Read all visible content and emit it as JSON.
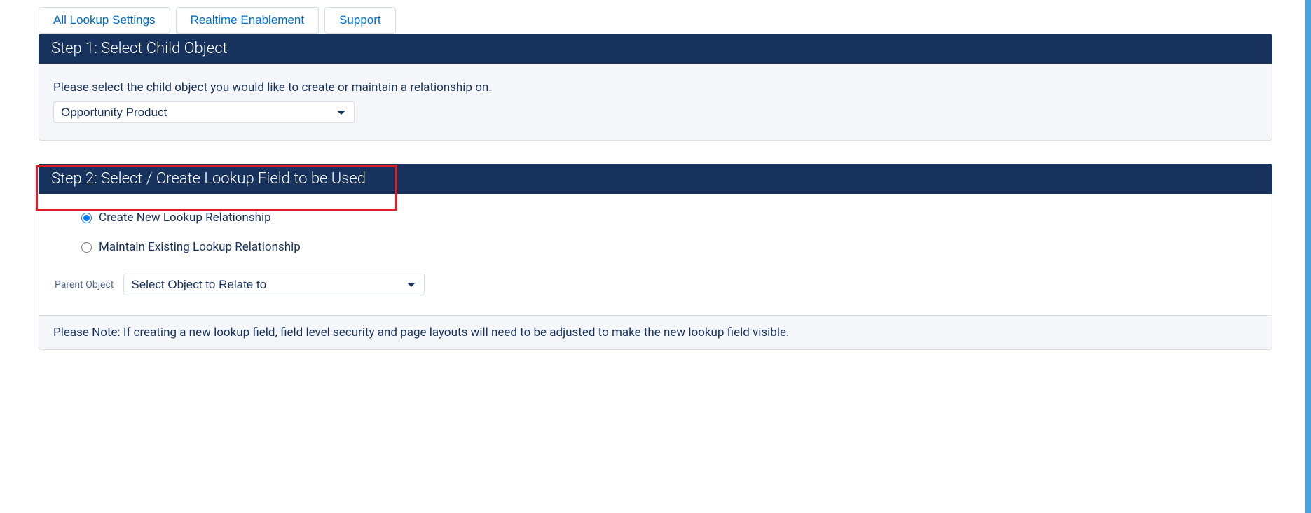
{
  "tabs": {
    "all_lookup_settings": "All Lookup Settings",
    "realtime_enablement": "Realtime Enablement",
    "support": "Support"
  },
  "step1": {
    "title": "Step 1: Select Child Object",
    "instruction": "Please select the child object you would like to create or maintain a relationship on.",
    "select_value": "Opportunity Product"
  },
  "step2": {
    "title": "Step 2: Select / Create Lookup Field to be Used",
    "radio_create": "Create New Lookup Relationship",
    "radio_maintain": "Maintain Existing Lookup Relationship",
    "parent_label": "Parent Object",
    "parent_select_value": "Select Object to Relate to",
    "note": "Please Note: If creating a new lookup field, field level security and page layouts will need to be adjusted to make the new lookup field visible."
  }
}
